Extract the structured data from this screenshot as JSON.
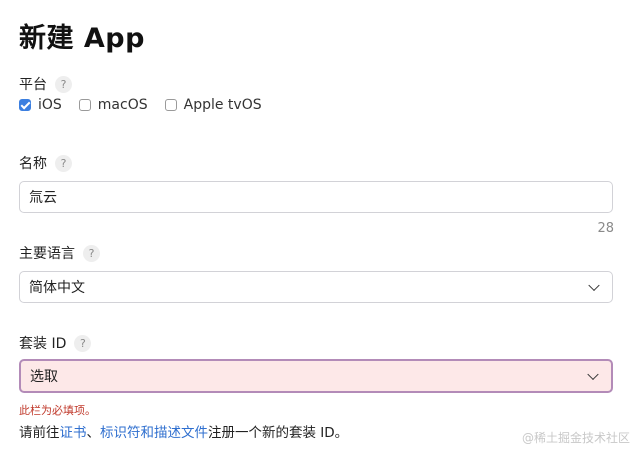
{
  "page": {
    "title": "新建 App"
  },
  "platform": {
    "label": "平台",
    "help": "?",
    "options": [
      {
        "label": "iOS",
        "checked": true
      },
      {
        "label": "macOS",
        "checked": false
      },
      {
        "label": "Apple tvOS",
        "checked": false
      }
    ]
  },
  "name_field": {
    "label": "名称",
    "help": "?",
    "value": "氚云",
    "counter": "28"
  },
  "language": {
    "label": "主要语言",
    "help": "?",
    "selected": "简体中文"
  },
  "bundle_id": {
    "label": "套装 ID",
    "help": "?",
    "selected": "选取",
    "error": "此栏为必填项。"
  },
  "footer_note": {
    "prefix": "请前往",
    "link_certs": "证书",
    "separator": "、",
    "link_ids": "标识符和描述文件",
    "suffix": "注册一个新的套装 ID。"
  },
  "watermark": "@稀土掘金技术社区",
  "colors": {
    "accent": "#3b7fe0",
    "link": "#2f6fcf",
    "error_text": "#c0392b",
    "error_bg": "#fde8e8",
    "error_border": "#b38bb8"
  },
  "icons": {
    "help": "question-mark-icon",
    "select": "chevron-down-icon",
    "checkbox": "checkbox-icon"
  }
}
